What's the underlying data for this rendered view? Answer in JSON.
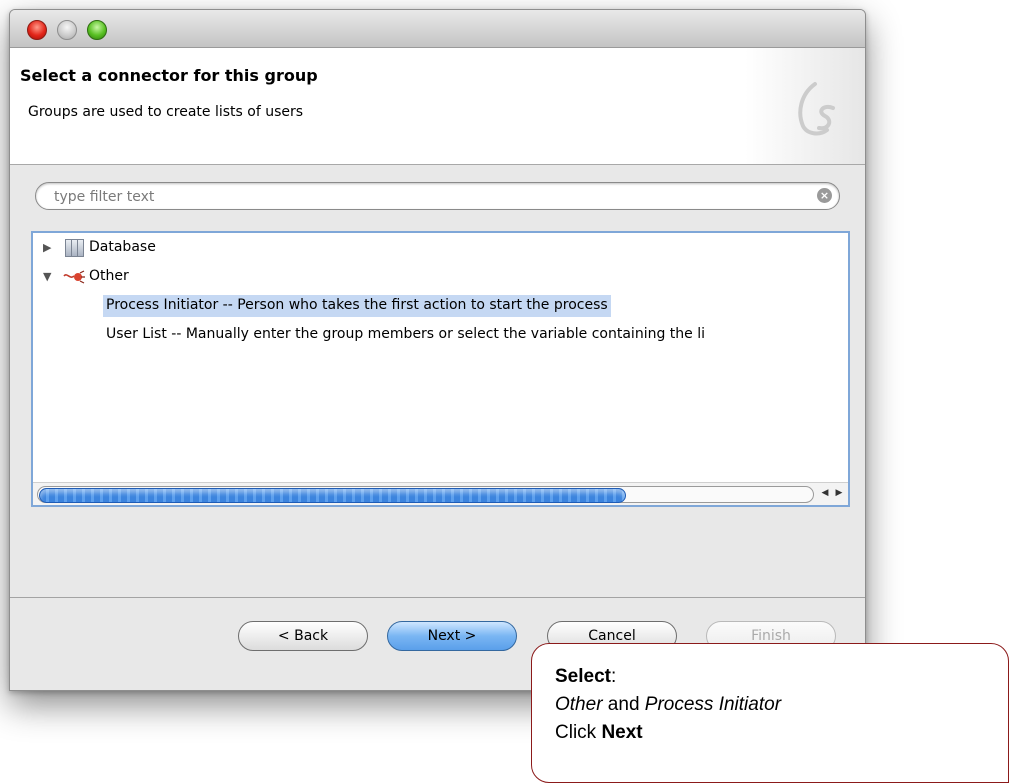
{
  "window": {
    "header_title": "Select a connector for this group",
    "header_description": "Groups are used to create lists of users",
    "logo_text": "6s"
  },
  "filter": {
    "placeholder": "type filter text",
    "value": ""
  },
  "tree": {
    "items": [
      {
        "label": "Database",
        "expanded": false,
        "icon": "database-icon"
      },
      {
        "label": "Other",
        "expanded": true,
        "icon": "connector-icon"
      }
    ],
    "children": [
      {
        "label": "Process Initiator -- Person who takes the first action to start the process",
        "selected": true
      },
      {
        "label": "User List -- Manually enter the group members or select the variable containing the li",
        "selected": false
      }
    ]
  },
  "buttons": {
    "back": "< Back",
    "next": "Next >",
    "cancel": "Cancel",
    "finish": "Finish"
  },
  "callout": {
    "select_bold": "Select",
    "select_colon": ":",
    "other": "Other",
    "and": " and ",
    "process_initiator": "Process Initiator",
    "click": "Click ",
    "next_bold": "Next"
  },
  "colors": {
    "selection": "#c5d8f3",
    "focus_border": "#7fa7d8",
    "callout_border": "#8b1a1a"
  }
}
